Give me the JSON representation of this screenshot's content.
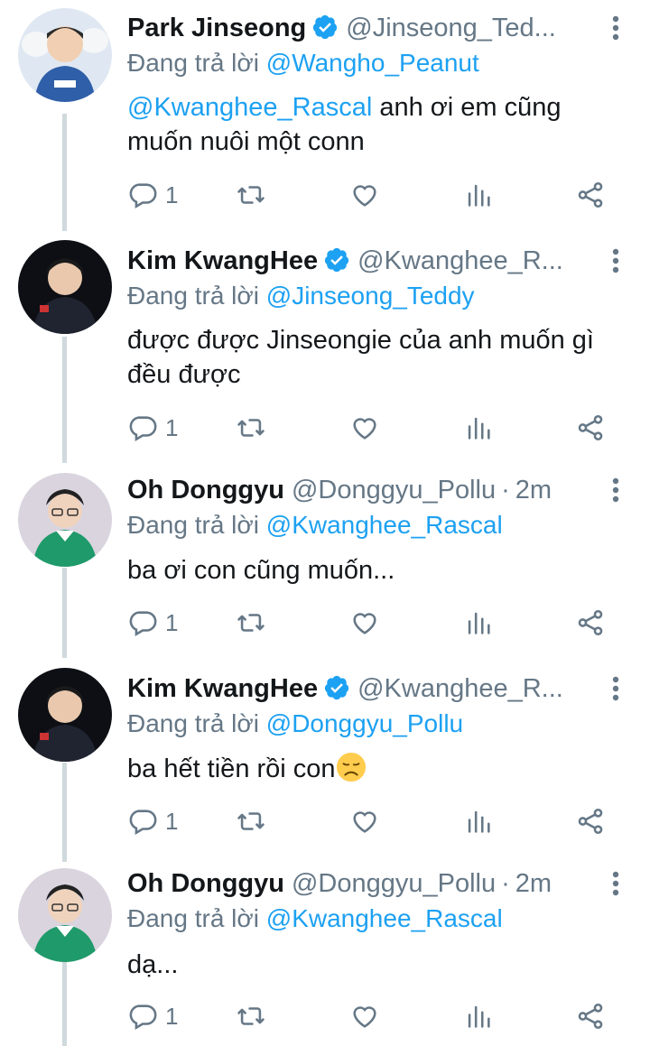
{
  "tweets": [
    {
      "name": "Park Jinseong",
      "verified": true,
      "handle": "@Jinseong_Ted...",
      "time": "",
      "reply_prefix": "Đang trả lời",
      "reply_to": "@Wangho_Peanut",
      "body_mention": "@Kwanghee_Rascal",
      "body_text": " anh ơi em cũng muốn nuôi một conn",
      "reply_count": "1"
    },
    {
      "name": "Kim KwangHee",
      "verified": true,
      "handle": "@Kwanghee_R...",
      "time": "",
      "reply_prefix": "Đang trả lời",
      "reply_to": "@Jinseong_Teddy",
      "body_mention": "",
      "body_text": "được được Jinseongie của anh muốn gì đều được",
      "reply_count": "1"
    },
    {
      "name": "Oh Donggyu",
      "verified": false,
      "handle": "@Donggyu_Pollu",
      "time": "2m",
      "reply_prefix": "Đang trả lời",
      "reply_to": "@Kwanghee_Rascal",
      "body_mention": "",
      "body_text": "ba ơi con cũng muốn...",
      "reply_count": "1"
    },
    {
      "name": "Kim KwangHee",
      "verified": true,
      "handle": "@Kwanghee_R...",
      "time": "",
      "reply_prefix": "Đang trả lời",
      "reply_to": "@Donggyu_Pollu",
      "body_mention": "",
      "body_text": "ba hết tiền rồi con",
      "body_emoji": "disappointed-face",
      "reply_count": "1"
    },
    {
      "name": "Oh Donggyu",
      "verified": false,
      "handle": "@Donggyu_Pollu",
      "time": "2m",
      "reply_prefix": "Đang trả lời",
      "reply_to": "@Kwanghee_Rascal",
      "body_mention": "",
      "body_text": "dạ...",
      "reply_count": "1"
    }
  ],
  "colors": {
    "link": "#1da1f2",
    "muted": "#657786",
    "text": "#14171a",
    "thread_line": "#cfd9de"
  },
  "icons": {
    "reply": "comment-icon",
    "retweet": "retweet-icon",
    "like": "heart-icon",
    "stats": "analytics-icon",
    "share": "share-icon",
    "more": "more-vertical-icon",
    "verified": "verified-badge-icon"
  }
}
